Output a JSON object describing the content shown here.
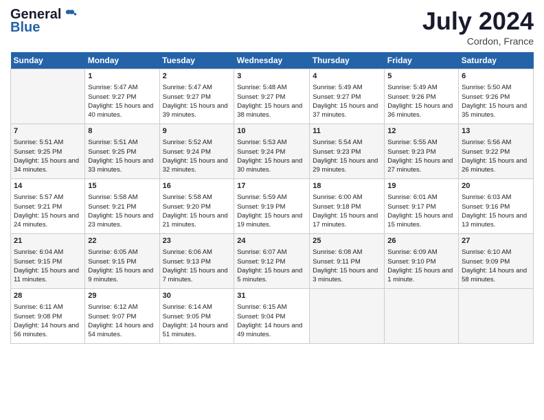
{
  "header": {
    "logo_general": "General",
    "logo_blue": "Blue",
    "month_year": "July 2024",
    "location": "Cordon, France"
  },
  "columns": [
    "Sunday",
    "Monday",
    "Tuesday",
    "Wednesday",
    "Thursday",
    "Friday",
    "Saturday"
  ],
  "weeks": [
    [
      {
        "day": "",
        "empty": true
      },
      {
        "day": "1",
        "sunrise": "Sunrise: 5:47 AM",
        "sunset": "Sunset: 9:27 PM",
        "daylight": "Daylight: 15 hours and 40 minutes."
      },
      {
        "day": "2",
        "sunrise": "Sunrise: 5:47 AM",
        "sunset": "Sunset: 9:27 PM",
        "daylight": "Daylight: 15 hours and 39 minutes."
      },
      {
        "day": "3",
        "sunrise": "Sunrise: 5:48 AM",
        "sunset": "Sunset: 9:27 PM",
        "daylight": "Daylight: 15 hours and 38 minutes."
      },
      {
        "day": "4",
        "sunrise": "Sunrise: 5:49 AM",
        "sunset": "Sunset: 9:27 PM",
        "daylight": "Daylight: 15 hours and 37 minutes."
      },
      {
        "day": "5",
        "sunrise": "Sunrise: 5:49 AM",
        "sunset": "Sunset: 9:26 PM",
        "daylight": "Daylight: 15 hours and 36 minutes."
      },
      {
        "day": "6",
        "sunrise": "Sunrise: 5:50 AM",
        "sunset": "Sunset: 9:26 PM",
        "daylight": "Daylight: 15 hours and 35 minutes."
      }
    ],
    [
      {
        "day": "7",
        "sunrise": "Sunrise: 5:51 AM",
        "sunset": "Sunset: 9:25 PM",
        "daylight": "Daylight: 15 hours and 34 minutes."
      },
      {
        "day": "8",
        "sunrise": "Sunrise: 5:51 AM",
        "sunset": "Sunset: 9:25 PM",
        "daylight": "Daylight: 15 hours and 33 minutes."
      },
      {
        "day": "9",
        "sunrise": "Sunrise: 5:52 AM",
        "sunset": "Sunset: 9:24 PM",
        "daylight": "Daylight: 15 hours and 32 minutes."
      },
      {
        "day": "10",
        "sunrise": "Sunrise: 5:53 AM",
        "sunset": "Sunset: 9:24 PM",
        "daylight": "Daylight: 15 hours and 30 minutes."
      },
      {
        "day": "11",
        "sunrise": "Sunrise: 5:54 AM",
        "sunset": "Sunset: 9:23 PM",
        "daylight": "Daylight: 15 hours and 29 minutes."
      },
      {
        "day": "12",
        "sunrise": "Sunrise: 5:55 AM",
        "sunset": "Sunset: 9:23 PM",
        "daylight": "Daylight: 15 hours and 27 minutes."
      },
      {
        "day": "13",
        "sunrise": "Sunrise: 5:56 AM",
        "sunset": "Sunset: 9:22 PM",
        "daylight": "Daylight: 15 hours and 26 minutes."
      }
    ],
    [
      {
        "day": "14",
        "sunrise": "Sunrise: 5:57 AM",
        "sunset": "Sunset: 9:21 PM",
        "daylight": "Daylight: 15 hours and 24 minutes."
      },
      {
        "day": "15",
        "sunrise": "Sunrise: 5:58 AM",
        "sunset": "Sunset: 9:21 PM",
        "daylight": "Daylight: 15 hours and 23 minutes."
      },
      {
        "day": "16",
        "sunrise": "Sunrise: 5:58 AM",
        "sunset": "Sunset: 9:20 PM",
        "daylight": "Daylight: 15 hours and 21 minutes."
      },
      {
        "day": "17",
        "sunrise": "Sunrise: 5:59 AM",
        "sunset": "Sunset: 9:19 PM",
        "daylight": "Daylight: 15 hours and 19 minutes."
      },
      {
        "day": "18",
        "sunrise": "Sunrise: 6:00 AM",
        "sunset": "Sunset: 9:18 PM",
        "daylight": "Daylight: 15 hours and 17 minutes."
      },
      {
        "day": "19",
        "sunrise": "Sunrise: 6:01 AM",
        "sunset": "Sunset: 9:17 PM",
        "daylight": "Daylight: 15 hours and 15 minutes."
      },
      {
        "day": "20",
        "sunrise": "Sunrise: 6:03 AM",
        "sunset": "Sunset: 9:16 PM",
        "daylight": "Daylight: 15 hours and 13 minutes."
      }
    ],
    [
      {
        "day": "21",
        "sunrise": "Sunrise: 6:04 AM",
        "sunset": "Sunset: 9:15 PM",
        "daylight": "Daylight: 15 hours and 11 minutes."
      },
      {
        "day": "22",
        "sunrise": "Sunrise: 6:05 AM",
        "sunset": "Sunset: 9:15 PM",
        "daylight": "Daylight: 15 hours and 9 minutes."
      },
      {
        "day": "23",
        "sunrise": "Sunrise: 6:06 AM",
        "sunset": "Sunset: 9:13 PM",
        "daylight": "Daylight: 15 hours and 7 minutes."
      },
      {
        "day": "24",
        "sunrise": "Sunrise: 6:07 AM",
        "sunset": "Sunset: 9:12 PM",
        "daylight": "Daylight: 15 hours and 5 minutes."
      },
      {
        "day": "25",
        "sunrise": "Sunrise: 6:08 AM",
        "sunset": "Sunset: 9:11 PM",
        "daylight": "Daylight: 15 hours and 3 minutes."
      },
      {
        "day": "26",
        "sunrise": "Sunrise: 6:09 AM",
        "sunset": "Sunset: 9:10 PM",
        "daylight": "Daylight: 15 hours and 1 minute."
      },
      {
        "day": "27",
        "sunrise": "Sunrise: 6:10 AM",
        "sunset": "Sunset: 9:09 PM",
        "daylight": "Daylight: 14 hours and 58 minutes."
      }
    ],
    [
      {
        "day": "28",
        "sunrise": "Sunrise: 6:11 AM",
        "sunset": "Sunset: 9:08 PM",
        "daylight": "Daylight: 14 hours and 56 minutes."
      },
      {
        "day": "29",
        "sunrise": "Sunrise: 6:12 AM",
        "sunset": "Sunset: 9:07 PM",
        "daylight": "Daylight: 14 hours and 54 minutes."
      },
      {
        "day": "30",
        "sunrise": "Sunrise: 6:14 AM",
        "sunset": "Sunset: 9:05 PM",
        "daylight": "Daylight: 14 hours and 51 minutes."
      },
      {
        "day": "31",
        "sunrise": "Sunrise: 6:15 AM",
        "sunset": "Sunset: 9:04 PM",
        "daylight": "Daylight: 14 hours and 49 minutes."
      },
      {
        "day": "",
        "empty": true
      },
      {
        "day": "",
        "empty": true
      },
      {
        "day": "",
        "empty": true
      }
    ]
  ]
}
